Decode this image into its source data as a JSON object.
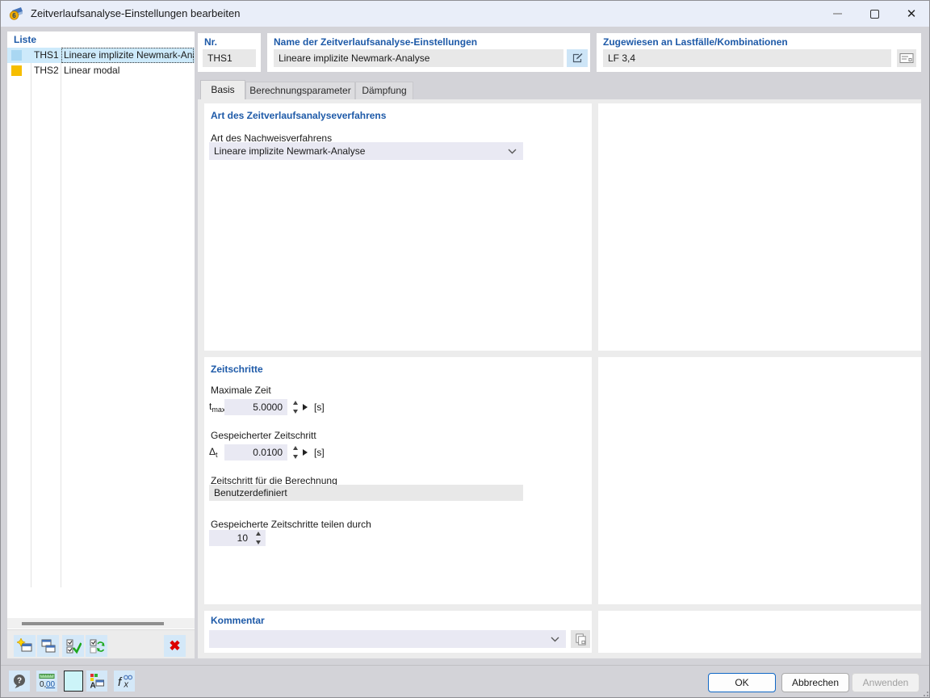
{
  "window": {
    "title": "Zeitverlaufsanalyse-Einstellungen bearbeiten"
  },
  "list": {
    "header": "Liste",
    "items": [
      {
        "id": "THS1",
        "name": "Lineare implizite Newmark-Analyse",
        "swatch": "background:#a9d7f2",
        "selected": true
      },
      {
        "id": "THS2",
        "name": "Linear modal",
        "swatch": "background:#f6be00",
        "selected": false
      }
    ]
  },
  "header_fields": {
    "nr_label": "Nr.",
    "nr_value": "THS1",
    "name_label": "Name der Zeitverlaufsanalyse-Einstellungen",
    "name_value": "Lineare implizite Newmark-Analyse",
    "assigned_label": "Zugewiesen an Lastfälle/Kombinationen",
    "assigned_value": "LF 3,4"
  },
  "tabs": {
    "active": "Basis",
    "items": [
      {
        "label": "Basis"
      },
      {
        "label": "Berechnungsparameter"
      },
      {
        "label": "Dämpfung"
      }
    ]
  },
  "basis_tab": {
    "analysis_section_title": "Art des Zeitverlaufsanalyseverfahrens",
    "method_label": "Art des Nachweisverfahrens",
    "method_value": "Lineare implizite Newmark-Analyse",
    "timesteps_section_title": "Zeitschritte",
    "max_time_label": "Maximale Zeit",
    "tmax_symbol": "t",
    "tmax_symbol_sub": "max",
    "tmax_value": "5.0000",
    "tmax_unit": "[s]",
    "saved_step_label": "Gespeicherter Zeitschritt",
    "dt_symbol": "Δ",
    "dt_symbol_sub": "t",
    "dt_value": "0.0100",
    "dt_unit": "[s]",
    "calc_step_label": "Zeitschritt für die Berechnung",
    "calc_step_value": "Benutzerdefiniert",
    "divide_label": "Gespeicherte Zeitschritte teilen durch",
    "divide_value": "10"
  },
  "comment": {
    "section_title": "Kommentar",
    "value": ""
  },
  "footer": {
    "ok": "OK",
    "cancel": "Abbrechen",
    "apply": "Anwenden"
  },
  "colors": {
    "titlebar": "#e9eef9",
    "dialog_bg": "#d3d3d8",
    "content_bg": "#ececec",
    "label_blue": "#1e5aa8",
    "selected_row": "#cdeafb",
    "swatch_ths1": "#a9d7f2",
    "swatch_ths2": "#f6be00",
    "field_gray": "#e8e8e8",
    "combo_lavender": "#e9e9f3",
    "toolbar_btn_blue": "#d4e8f8",
    "ok_border_blue": "#1168c6",
    "delete_red": "#dd0000"
  }
}
